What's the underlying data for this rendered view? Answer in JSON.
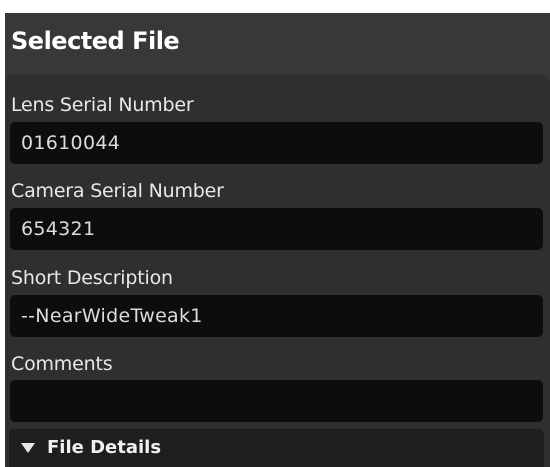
{
  "panel": {
    "title": "Selected File"
  },
  "fields": {
    "lens_serial": {
      "label": "Lens Serial Number",
      "value": "01610044"
    },
    "camera_serial": {
      "label": "Camera Serial Number",
      "value": "654321"
    },
    "short_description": {
      "label": "Short Description",
      "value": "--NearWideTweak1"
    },
    "comments": {
      "label": "Comments",
      "value": ""
    }
  },
  "file_details": {
    "label": "File Details",
    "expanded": true,
    "icon": "triangle-down-icon"
  },
  "colors": {
    "panel_background": "#383838",
    "field_background": "#0d0d0d",
    "text": "#ffffff"
  }
}
